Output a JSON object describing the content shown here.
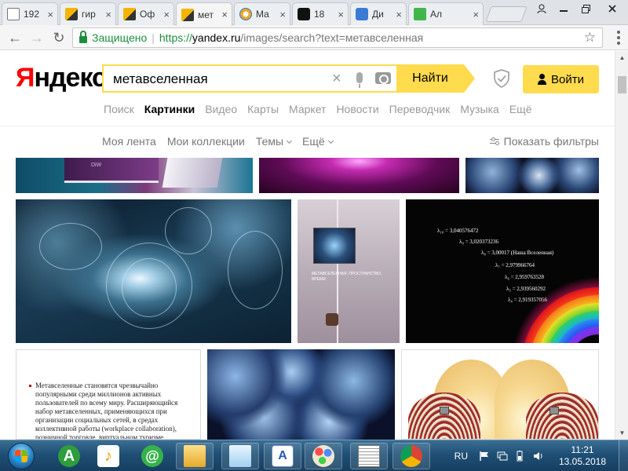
{
  "browser": {
    "tabs": [
      {
        "label": "192",
        "icon": "page-icon",
        "active": false
      },
      {
        "label": "гир",
        "icon": "image-icon",
        "active": false
      },
      {
        "label": "Оф",
        "icon": "image-icon",
        "active": false
      },
      {
        "label": "мет",
        "icon": "image-icon",
        "active": true
      },
      {
        "label": "Ма",
        "icon": "mail-icon",
        "active": false
      },
      {
        "label": "18",
        "icon": "ok-icon",
        "active": false
      },
      {
        "label": "Ди",
        "icon": "chat-icon",
        "active": false
      },
      {
        "label": "Ал",
        "icon": "app-icon",
        "active": false
      }
    ],
    "secure_label": "Защищено",
    "url_scheme": "https://",
    "url_host": "yandex.ru",
    "url_rest": "/images/search?text=метавселенная"
  },
  "yandex": {
    "logo_first": "Я",
    "logo_rest": "ндекс",
    "search_value": "метавселенная",
    "search_button": "Найти",
    "login_button": "Войти",
    "services": [
      {
        "label": "Поиск",
        "active": false
      },
      {
        "label": "Картинки",
        "active": true
      },
      {
        "label": "Видео",
        "active": false
      },
      {
        "label": "Карты",
        "active": false
      },
      {
        "label": "Маркет",
        "active": false
      },
      {
        "label": "Новости",
        "active": false
      },
      {
        "label": "Переводчик",
        "active": false
      },
      {
        "label": "Музыка",
        "active": false
      },
      {
        "label": "Ещё",
        "active": false
      }
    ],
    "subnav": {
      "feed": "Моя лента",
      "collections": "Мои коллекции",
      "themes": "Темы",
      "more": "Ещё"
    },
    "show_filters": "Показать фильтры"
  },
  "images": {
    "book1_caption": "DiW",
    "book2_caption": "МЕТАВСЕЛЕННАЯ. ПРОСТРАНСТВО, ВРЕМЯ",
    "rainbow_labels": [
      {
        "text": "λ₁₀ = 3,040576472"
      },
      {
        "text": "λ₉ = 3,020373236"
      },
      {
        "text": "λ₈ = 3,00017 (Наша Вселенная)"
      },
      {
        "text": "λ₇ = 2,979966764"
      },
      {
        "text": "λ₆ = 2,959763528"
      },
      {
        "text": "λ₅ = 2,939560292"
      },
      {
        "text": "λ₄ = 2,919357056"
      }
    ],
    "slide_text": "Метавселенные становятся чрезвычайно популярными среди миллионов активных пользователей по всему миру. Расширяющийся набор метавселенных, применяющихся при организации социальных сетей, в средах коллективной работы (workplace collaboration), розничной торговле, виртуальном туризме,"
  },
  "taskbar": {
    "language": "RU",
    "time": "11:21",
    "date": "13.05.2018"
  },
  "colors": {
    "yandex_yellow": "#ffdb4d",
    "yandex_red": "#ff0000",
    "secure_green": "#1e8e3e"
  }
}
